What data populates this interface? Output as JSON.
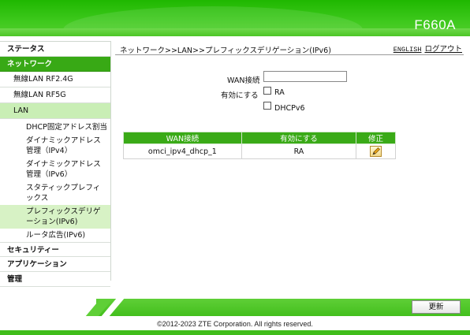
{
  "header": {
    "model": "F660A"
  },
  "sidebar": {
    "status": "ステータス",
    "network": "ネットワーク",
    "wlan24": "無線LAN RF2.4G",
    "wlan5": "無線LAN RF5G",
    "lan": "LAN",
    "lan_items": [
      "DHCP固定アドレス割当",
      "ダイナミックアドレス管理（IPv4）",
      "ダイナミックアドレス管理（IPv6）",
      "スタティックプレフィックス",
      "プレフィックスデリゲーション(IPv6)",
      "ルータ広告(IPv6)"
    ],
    "security": "セキュリティー",
    "application": "アプリケーション",
    "admin": "管理"
  },
  "content": {
    "breadcrumb": "ネットワーク>>LAN>>プレフィックスデリゲーション(IPv6)",
    "english_link": "ENGLISH",
    "logout_link": "ログアウト",
    "wan_label": "WAN接続",
    "wan_value": "",
    "enable_label": "有効にする",
    "ra_label": "RA",
    "dhcpv6_label": "DHCPv6"
  },
  "table": {
    "headers": [
      "WAN接続",
      "有効にする",
      "修正"
    ],
    "rows": [
      {
        "wan": "omci_ipv4_dhcp_1",
        "enabled": "RA"
      }
    ]
  },
  "footer": {
    "update_button": "更新",
    "copyright": "©2012-2023 ZTE Corporation. All rights reserved."
  },
  "colors": {
    "brand_green": "#3aaa17",
    "active_sub": "#c9eeb5"
  },
  "icons": {
    "edit": "pencil-edit-icon"
  }
}
